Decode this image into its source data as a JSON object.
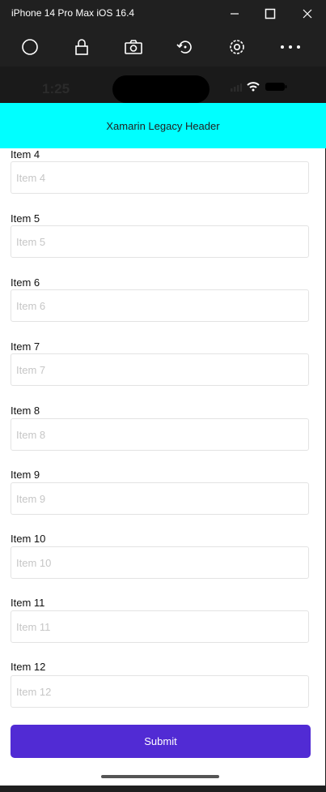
{
  "window": {
    "title": "iPhone 14 Pro Max iOS 16.4"
  },
  "status": {
    "time": "1:25"
  },
  "header": {
    "title": "Xamarin Legacy Header"
  },
  "form": {
    "items": [
      {
        "label": "Item 4",
        "placeholder": "Item 4"
      },
      {
        "label": "Item 5",
        "placeholder": "Item 5"
      },
      {
        "label": "Item 6",
        "placeholder": "Item 6"
      },
      {
        "label": "Item 7",
        "placeholder": "Item 7"
      },
      {
        "label": "Item 8",
        "placeholder": "Item 8"
      },
      {
        "label": "Item 9",
        "placeholder": "Item 9"
      },
      {
        "label": "Item 10",
        "placeholder": "Item 10"
      },
      {
        "label": "Item 11",
        "placeholder": "Item 11"
      },
      {
        "label": "Item 12",
        "placeholder": "Item 12"
      }
    ],
    "submit_label": "Submit"
  },
  "colors": {
    "header_bg": "#00ffff",
    "accent": "#512bd4"
  }
}
